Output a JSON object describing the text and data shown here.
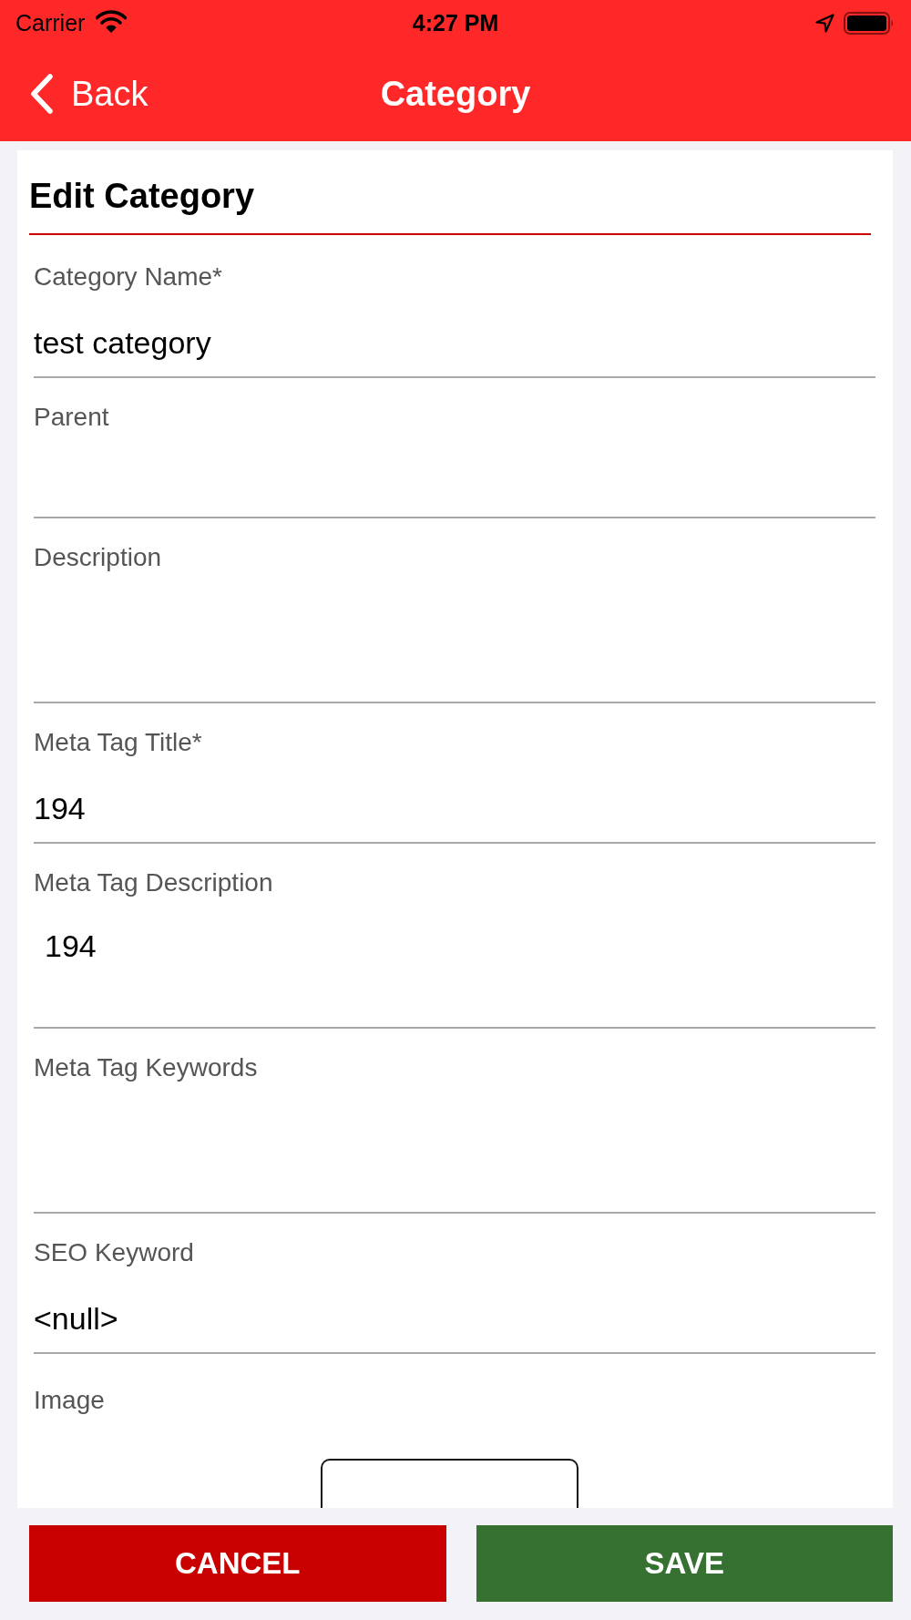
{
  "status_bar": {
    "carrier": "Carrier",
    "time": "4:27 PM"
  },
  "nav_bar": {
    "back_label": "Back",
    "title": "Category"
  },
  "form": {
    "title": "Edit Category",
    "fields": [
      {
        "kind": "text",
        "label": "Category Name*",
        "value": "test category"
      },
      {
        "kind": "text",
        "label": "Parent"
      },
      {
        "kind": "textarea",
        "label": "Description"
      },
      {
        "kind": "text",
        "label": "Meta Tag Title*",
        "value": "194"
      },
      {
        "kind": "textarea",
        "label": "Meta Tag Description",
        "value": "194"
      },
      {
        "kind": "textarea",
        "label": "Meta Tag Keywords"
      },
      {
        "kind": "text",
        "label": "SEO Keyword",
        "value": "<null>"
      },
      {
        "kind": "image",
        "label": "Image"
      }
    ]
  },
  "buttons": [
    {
      "kind": "cancel",
      "label": "CANCEL"
    },
    {
      "kind": "save",
      "label": "SAVE"
    }
  ]
}
